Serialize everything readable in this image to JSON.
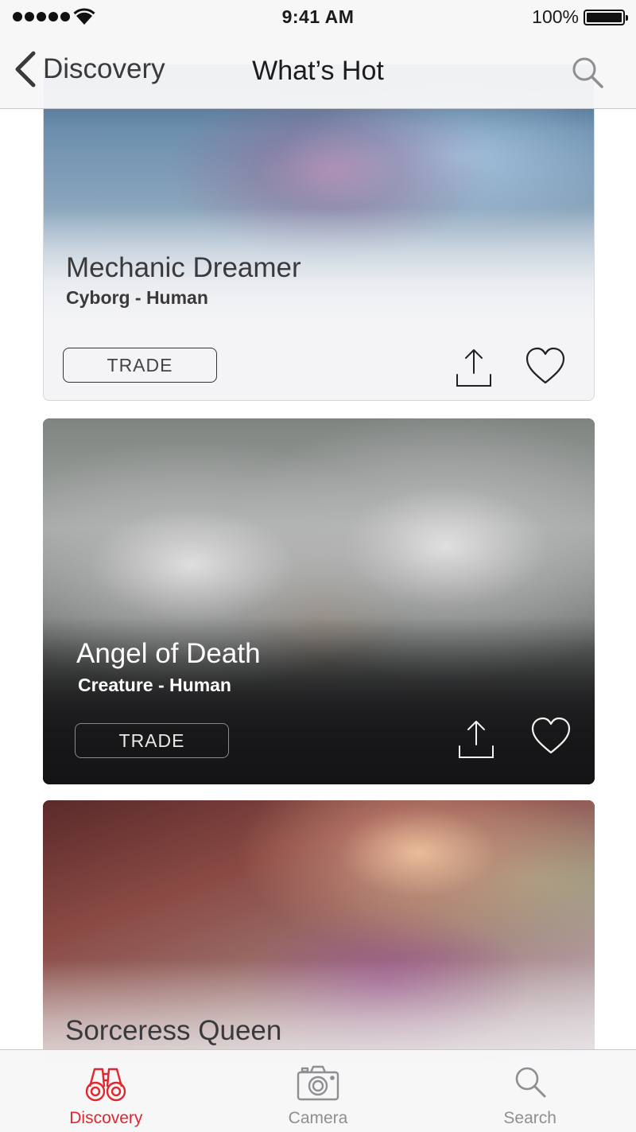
{
  "status_bar": {
    "time": "9:41 AM",
    "battery_percent": "100%",
    "signal_bars": 5
  },
  "nav": {
    "back_label": "Discovery",
    "title": "What’s Hot",
    "search_icon": "search-icon"
  },
  "cards": [
    {
      "title": "Mechanic Dreamer",
      "subtitle": "Cyborg - Human",
      "trade_label": "TRADE",
      "theme": "light"
    },
    {
      "title": "Angel of Death",
      "subtitle": "Creature - Human",
      "trade_label": "TRADE",
      "theme": "dark"
    },
    {
      "title": "Sorceress Queen",
      "theme": "light"
    }
  ],
  "tabbar": {
    "tabs": [
      {
        "label": "Discovery",
        "icon": "binoculars-icon",
        "active": true
      },
      {
        "label": "Camera",
        "icon": "camera-icon",
        "active": false
      },
      {
        "label": "Search",
        "icon": "search-icon",
        "active": false
      }
    ]
  },
  "colors": {
    "accent": "#e3262e",
    "tab_inactive": "#8e8e93",
    "nav_bg": "#f7f7f8"
  }
}
